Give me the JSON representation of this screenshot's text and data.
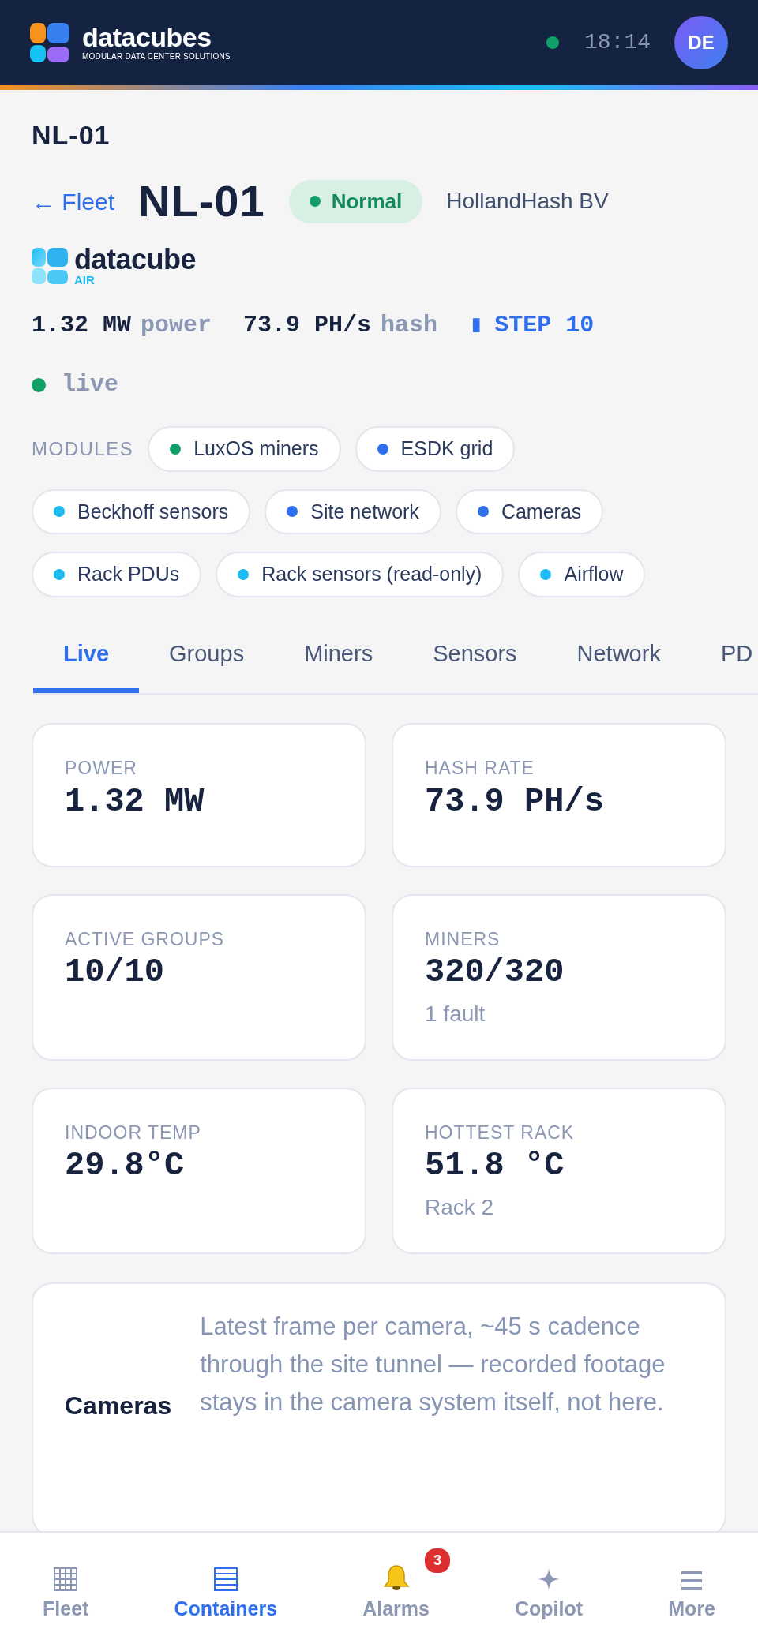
{
  "header": {
    "brand": "datacubes",
    "tagline": "MODULAR DATA CENTER SOLUTIONS",
    "connected": true,
    "time": "18:14",
    "avatar": "DE"
  },
  "page_title": "NL-01",
  "back_link": "← Fleet",
  "container": {
    "name": "NL-01",
    "status": "Normal",
    "owner": "HollandHash BV"
  },
  "product_logo": {
    "name": "datacube",
    "variant": "AIR"
  },
  "stats": [
    {
      "reading": "1.32 MW",
      "suffix": "power"
    },
    {
      "reading": "73.9 PH/s",
      "suffix": "hash"
    }
  ],
  "step": {
    "marker": "▮",
    "label": "STEP 10"
  },
  "live": {
    "on": true,
    "label": "live"
  },
  "modules": {
    "label": "MODULES",
    "items": [
      {
        "name": "LuxOS miners",
        "color": "#12a06a"
      },
      {
        "name": "ESDK grid",
        "color": "#2f6fed"
      },
      {
        "name": "Beckhoff sensors",
        "color": "#1cbcf5"
      },
      {
        "name": "Site network",
        "color": "#2f6fed"
      },
      {
        "name": "Cameras",
        "color": "#2f6fed"
      },
      {
        "name": "Rack PDUs",
        "color": "#1cbcf5"
      },
      {
        "name": "Rack sensors (read-only)",
        "color": "#1cbcf5"
      },
      {
        "name": "Airflow",
        "color": "#1cbcf5"
      }
    ]
  },
  "tabs": [
    {
      "label": "Live",
      "selected": true
    },
    {
      "label": "Groups",
      "selected": false
    },
    {
      "label": "Miners",
      "selected": false
    },
    {
      "label": "Sensors",
      "selected": false
    },
    {
      "label": "Network",
      "selected": false
    },
    {
      "label": "PD",
      "selected": false
    }
  ],
  "metrics": [
    {
      "label": "POWER",
      "value": "1.32 MW"
    },
    {
      "label": "HASH RATE",
      "value": "73.9 PH/s"
    },
    {
      "label": "ACTIVE GROUPS",
      "value": "10/10"
    },
    {
      "label": "MINERS",
      "value": "320/320",
      "sub": "1 fault"
    },
    {
      "label": "INDOOR TEMP",
      "value": "29.8°C"
    },
    {
      "label": "HOTTEST RACK",
      "value": "51.8 °C",
      "sub": "Rack 2"
    }
  ],
  "cameras": {
    "title": "Cameras",
    "description": "Latest frame per camera, ~45 s cadence through the site tunnel — recorded footage stays in the camera system itself, not here."
  },
  "bottom_nav": [
    {
      "kind": "grid",
      "label": "Fleet",
      "selected": false
    },
    {
      "kind": "list",
      "label": "Containers",
      "selected": true
    },
    {
      "kind": "bell",
      "label": "Alarms",
      "selected": false,
      "badge": "3"
    },
    {
      "kind": "sparkle",
      "label": "Copilot",
      "selected": false
    },
    {
      "kind": "menu",
      "label": "More",
      "selected": false
    }
  ]
}
